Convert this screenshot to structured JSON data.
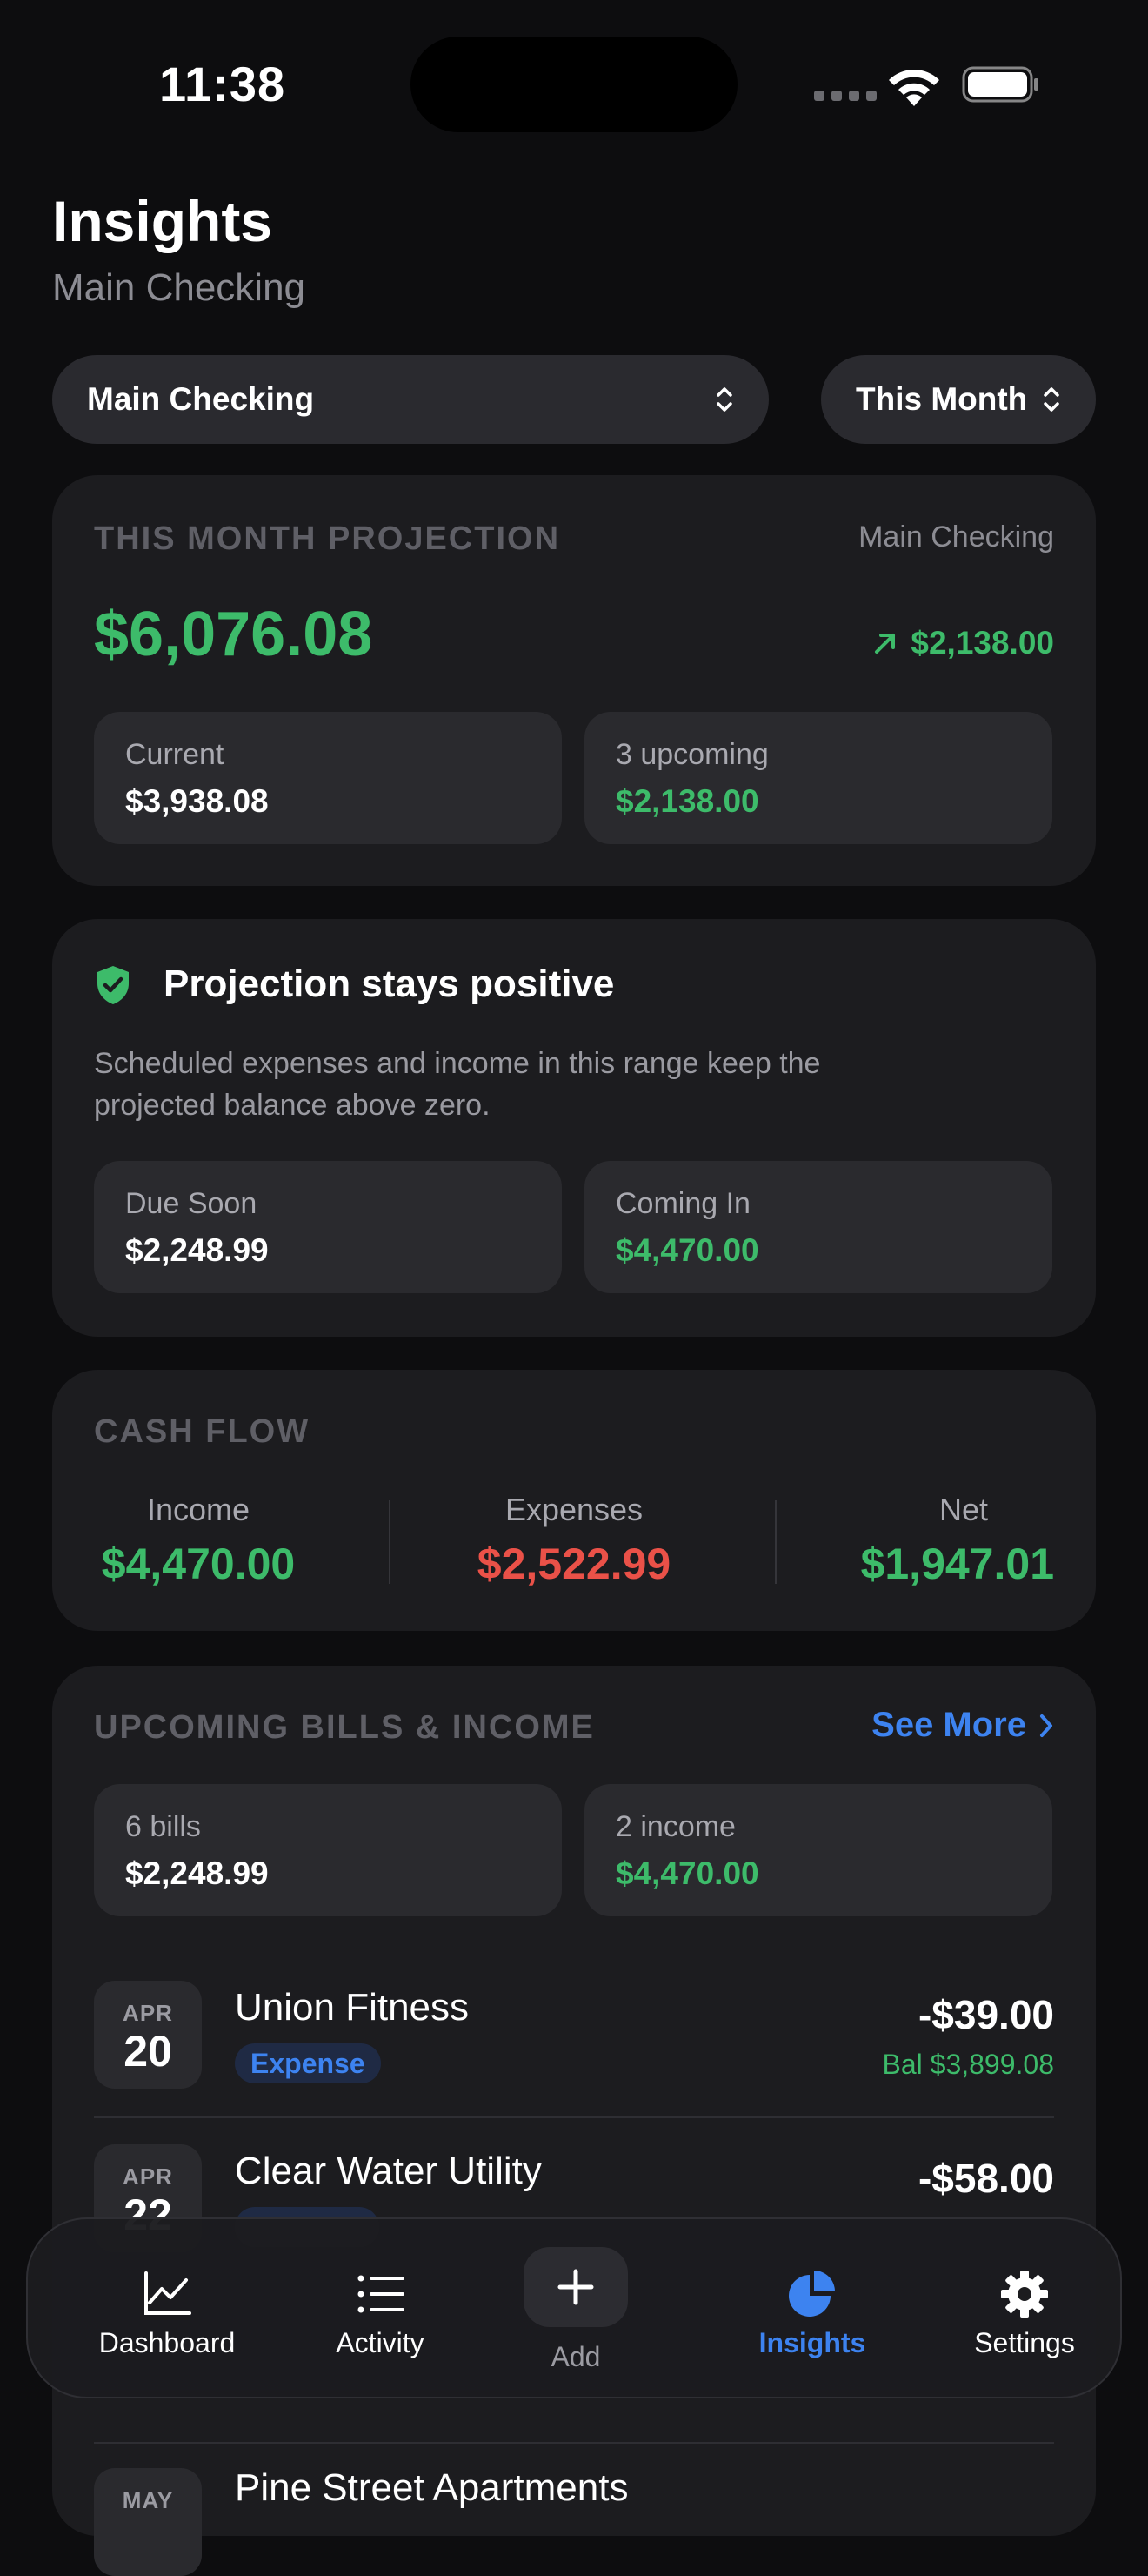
{
  "status": {
    "time": "11:38"
  },
  "header": {
    "title": "Insights",
    "subtitle": "Main Checking"
  },
  "pickers": {
    "account": "Main Checking",
    "period": "This Month"
  },
  "projection": {
    "heading": "THIS MONTH PROJECTION",
    "account": "Main Checking",
    "amount": "$6,076.08",
    "change": "$2,138.00",
    "current_label": "Current",
    "current_value": "$3,938.08",
    "upcoming_label": "3 upcoming",
    "upcoming_value": "$2,138.00"
  },
  "status_card": {
    "title": "Projection stays positive",
    "description_line1": "Scheduled expenses and income in this range keep the",
    "description_line2": "projected balance above zero.",
    "due_label": "Due Soon",
    "due_value": "$2,248.99",
    "coming_label": "Coming In",
    "coming_value": "$4,470.00"
  },
  "cash_flow": {
    "heading": "CASH FLOW",
    "income_label": "Income",
    "income_value": "$4,470.00",
    "expenses_label": "Expenses",
    "expenses_value": "$2,522.99",
    "net_label": "Net",
    "net_value": "$1,947.01"
  },
  "upcoming": {
    "heading": "UPCOMING BILLS & INCOME",
    "see_more": "See More",
    "bills_label": "6 bills",
    "bills_value": "$2,248.99",
    "income_label": "2 income",
    "income_value": "$4,470.00",
    "items": [
      {
        "month": "APR",
        "day": "20",
        "name": "Union Fitness",
        "tag": "Expense",
        "amount": "-$39.00",
        "balance": "Bal $3,899.08"
      },
      {
        "month": "APR",
        "day": "22",
        "name": "Clear Water Utility",
        "amount": "-$58.00"
      },
      {
        "month": "MAY",
        "name": "Pine Street Apartments"
      }
    ]
  },
  "tabbar": {
    "dashboard": "Dashboard",
    "activity": "Activity",
    "add": "Add",
    "insights": "Insights",
    "settings": "Settings"
  },
  "colors": {
    "accent": "#3d83f0",
    "positive": "#3dbb6a",
    "negative": "#ea5148",
    "background": "#0d0d0f",
    "card": "#1c1c1f"
  }
}
